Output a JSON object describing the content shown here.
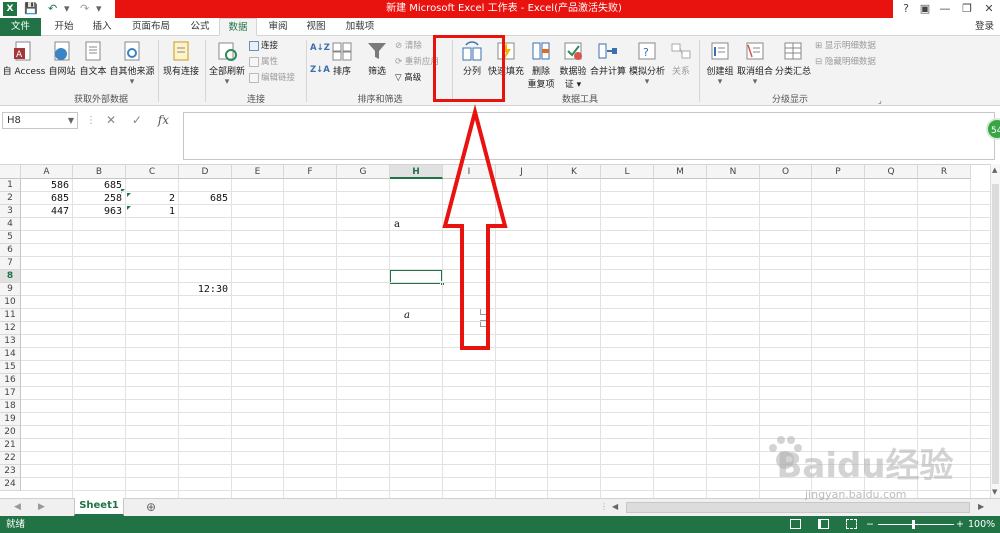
{
  "title_bar": {
    "title": "新建 Microsoft Excel 工作表 -  Excel(产品激活失败)",
    "help_icon": "?",
    "controls": [
      "?",
      "▣",
      "—",
      "❐",
      "✕"
    ]
  },
  "tabs": [
    {
      "label": "文件",
      "name": "tab-file"
    },
    {
      "label": "开始",
      "name": "tab-home"
    },
    {
      "label": "插入",
      "name": "tab-insert"
    },
    {
      "label": "页面布局",
      "name": "tab-page-layout"
    },
    {
      "label": "公式",
      "name": "tab-formulas"
    },
    {
      "label": "数据",
      "name": "tab-data"
    },
    {
      "label": "审阅",
      "name": "tab-review"
    },
    {
      "label": "视图",
      "name": "tab-view"
    },
    {
      "label": "加载项",
      "name": "tab-addins"
    }
  ],
  "login": "登录",
  "ribbon": {
    "external_data": {
      "from_access": "自 Access",
      "from_web": "自网站",
      "from_text": "自文本",
      "from_other": "自其他来源",
      "existing": "现有连接",
      "group": "获取外部数据"
    },
    "connections": {
      "refresh_all": "全部刷新",
      "connections": "连接",
      "properties": "属性",
      "edit_links": "编辑链接",
      "group": "连接"
    },
    "sort_filter": {
      "sort": "排序",
      "filter": "筛选",
      "clear": "清除",
      "reapply": "重新应用",
      "advanced": "高级",
      "group": "排序和筛选"
    },
    "data_tools": {
      "text_to_columns": "分列",
      "flash_fill": "快速填充",
      "remove_dup_1": "删除",
      "remove_dup_2": "重复项",
      "validation_1": "数据验",
      "validation_2": "证 ▾",
      "consolidate": "合并计算",
      "what_if": "模拟分析",
      "relations": "关系",
      "group": "数据工具"
    },
    "outline": {
      "group_btn": "创建组",
      "ungroup": "取消组合",
      "subtotal": "分类汇总",
      "show_detail": "显示明细数据",
      "hide_detail": "隐藏明细数据",
      "group": "分级显示"
    }
  },
  "formula_bar": {
    "name_box": "H8",
    "formula": ""
  },
  "sheet": {
    "columns": [
      "A",
      "B",
      "C",
      "D",
      "E",
      "F",
      "G",
      "H",
      "I",
      "J",
      "K",
      "L",
      "M",
      "N",
      "O",
      "P",
      "Q",
      "R"
    ],
    "rows": [
      "1",
      "2",
      "3",
      "4",
      "5",
      "6",
      "7",
      "8",
      "9",
      "10",
      "11",
      "12",
      "13",
      "14",
      "15",
      "16",
      "17",
      "18",
      "19",
      "20",
      "21",
      "22",
      "23",
      "24"
    ],
    "selected_column": "H",
    "selected_row": "8",
    "cells": {
      "A1": "586",
      "B1": "685",
      "A2": "685",
      "B2": "258",
      "C2": "2",
      "D2": "685",
      "A3": "447",
      "B3": "963",
      "C3": "1",
      "H4": "a",
      "D9": "12:30",
      "H11": "a"
    }
  },
  "sheet_tabs": {
    "active": "Sheet1",
    "add": "⊕"
  },
  "status": {
    "ready": "就绪",
    "zoom": "100%",
    "zoom_minus": "−",
    "zoom_plus": "+"
  },
  "badge": "54",
  "watermark_text": "Baidu经验",
  "watermark_url": "jingyan.baidu.com",
  "colors": {
    "excel_green": "#217346",
    "title_red": "#e8120f",
    "annotation_red": "#e8120f"
  }
}
